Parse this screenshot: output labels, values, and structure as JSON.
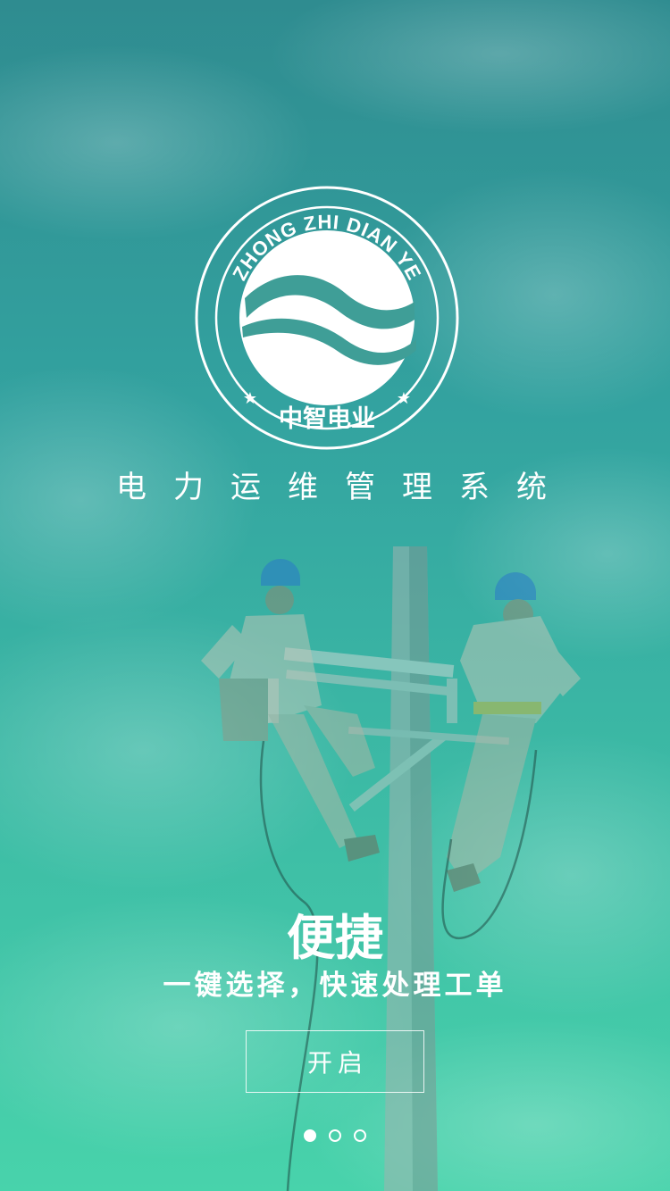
{
  "brand": {
    "logo_arc_text": "ZHONG ZHI DIAN YE",
    "logo_chinese": "中智电业",
    "app_title": "电力运维管理系统"
  },
  "slide": {
    "title": "便捷",
    "subtitle": "一键选择，快速处理工单",
    "button_label": "开启",
    "background_image": "linemen-on-utility-pole",
    "overlay_color_top": "#2f8c90",
    "overlay_color_bottom": "#48d3ab"
  },
  "pager": {
    "total_pages": 3,
    "active_page": 1
  }
}
